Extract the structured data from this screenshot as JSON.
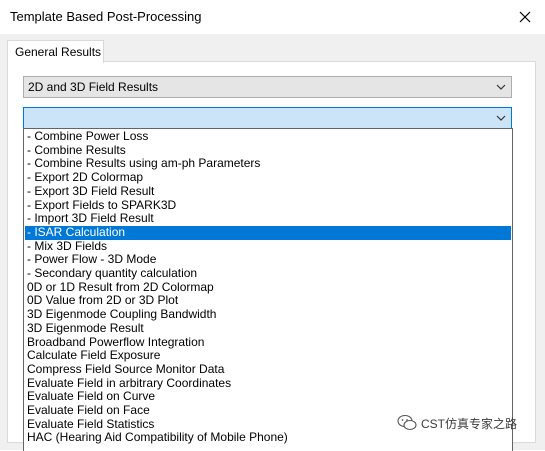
{
  "window": {
    "title": "Template Based Post-Processing"
  },
  "tabs": [
    {
      "label": "General Results"
    }
  ],
  "category_select": {
    "value": "2D and 3D Field Results"
  },
  "template_select": {
    "value": ""
  },
  "dropdown": {
    "selected_index": 7,
    "items": [
      "- Combine Power Loss",
      "- Combine Results",
      "- Combine Results using am-ph Parameters",
      "- Export 2D Colormap",
      "- Export 3D Field Result",
      "- Export Fields to SPARK3D",
      "- Import 3D Field Result",
      "- ISAR Calculation",
      "- Mix 3D Fields",
      "- Power Flow - 3D Mode",
      "- Secondary quantity calculation",
      "0D or 1D Result from 2D Colormap",
      "0D Value from 2D or 3D Plot",
      "3D Eigenmode Coupling Bandwidth",
      "3D Eigenmode Result",
      "Broadband Powerflow Integration",
      "Calculate Field Exposure",
      "Compress Field Source Monitor Data",
      "Evaluate Field in arbitrary Coordinates",
      "Evaluate Field on Curve",
      "Evaluate Field on Face",
      "Evaluate Field Statistics",
      "HAC (Hearing Aid Compatibility of Mobile Phone)"
    ]
  },
  "watermark": {
    "text": "CST仿真专家之路"
  },
  "colors": {
    "selection": "#0078d7",
    "focus_border": "#0078d7",
    "combo_focus_bg": "#cce4f7"
  }
}
